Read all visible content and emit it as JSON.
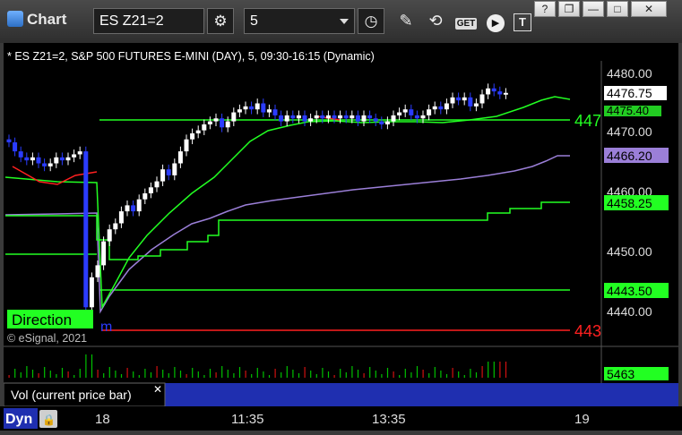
{
  "window": {
    "title": "Chart",
    "help_label": "?",
    "restore_label": "❐",
    "minimize_label": "—",
    "maximize_label": "□",
    "close_label": "✕"
  },
  "toolbar": {
    "symbol_value": "ES Z21=2",
    "interval_value": "5",
    "get_label": "GET"
  },
  "chart": {
    "header": "* ES Z21=2, S&P 500 FUTURES E-MINI (DAY), 5, 09:30-16:15 (Dynamic)",
    "watermark": "© eSignal, 2021",
    "direction_label": "Direction",
    "direction_suffix": "m",
    "price_ticks": [
      "4480.00",
      "4470.00",
      "4460.00",
      "4450.00",
      "4440.00"
    ],
    "line_labels": {
      "last_price": "4476.75",
      "green_upper_hidden": "4475.40",
      "green_line_447": "447",
      "purple": "4466.20",
      "green_458": "4458.25",
      "green_443": "4443.50",
      "red_443": "443"
    },
    "volume_panel": {
      "label": "Vol (current price bar)",
      "close_label": "✕",
      "value": "5463"
    },
    "time_axis": {
      "mode_label": "Dyn",
      "ticks": [
        "18",
        "11:35",
        "13:35",
        "19"
      ]
    }
  },
  "colors": {
    "up_candle": "#ffffff",
    "down_candle": "#2b3cff",
    "green_line": "#22ff22",
    "purple_line": "#9b7fd8",
    "red_line": "#ff2020",
    "volume_bar": "#00c000",
    "volume_spike": "#d01010",
    "dyn_bg": "#1f2fb0"
  },
  "chart_data": {
    "type": "candlestick",
    "title": "* ES Z21=2, S&P 500 FUTURES E-MINI (DAY), 5, 09:30-16:15 (Dynamic)",
    "ylim": [
      4435,
      4484
    ],
    "y_ticks": [
      4440,
      4450,
      4460,
      4470,
      4480
    ],
    "x_ticks": [
      "18",
      "11:35",
      "13:35",
      "19"
    ],
    "reference_lines": [
      {
        "value": 4473.0,
        "color": "#22ff22"
      },
      {
        "value": 4443.5,
        "color": "#22ff22"
      },
      {
        "value": 4436.5,
        "color": "#ff2020"
      }
    ],
    "last_price": 4476.75,
    "volume_last": 5463
  }
}
